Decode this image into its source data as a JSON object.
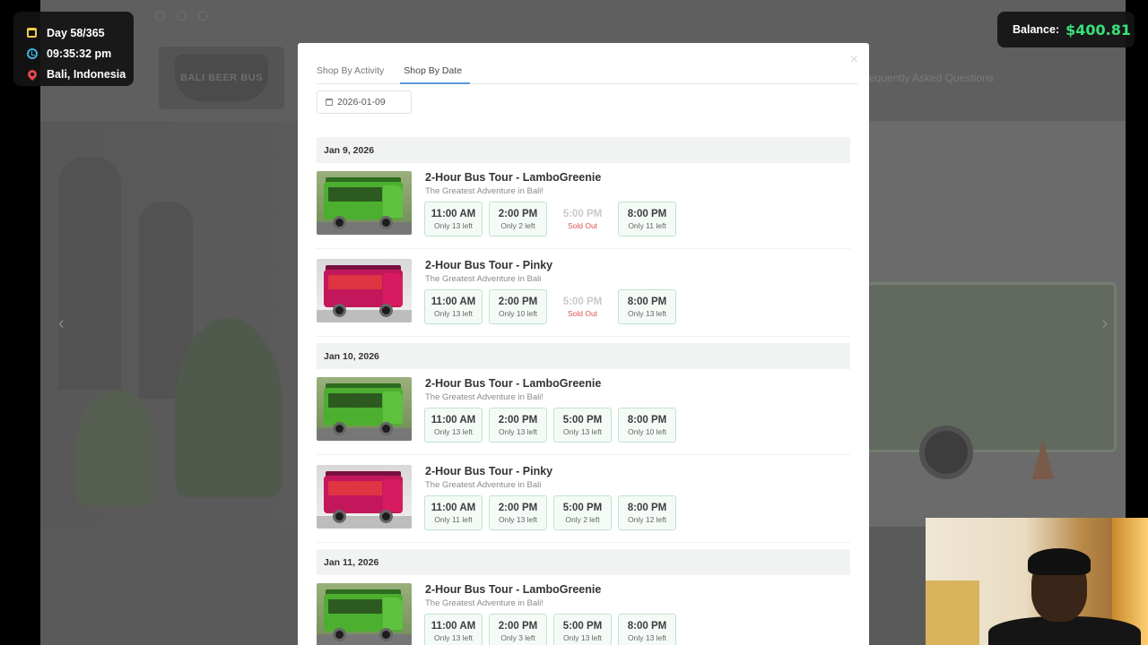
{
  "hud": {
    "day": "Day 58/365",
    "time": "09:35:32 pm",
    "location": "Bali, Indonesia"
  },
  "balance": {
    "label": "Balance:",
    "value": "$400.81",
    "value_color": "#39e07a"
  },
  "background_site": {
    "logo_text": "BALI BEER BUS",
    "nav_faq": "requently Asked Questions"
  },
  "modal": {
    "tabs": [
      {
        "label": "Shop By Activity",
        "active": false
      },
      {
        "label": "Shop By Date",
        "active": true
      }
    ],
    "date_value": "2026-01-09",
    "days": [
      {
        "date": "Jan 9, 2026",
        "tours": [
          {
            "name": "2-Hour Bus Tour - LamboGreenie",
            "tagline": "The Greatest Adventure in Bali!",
            "image": "green-bus",
            "slots": [
              {
                "time": "11:00 AM",
                "status": "Only 13 left",
                "sold_out": false
              },
              {
                "time": "2:00 PM",
                "status": "Only 2 left",
                "sold_out": false
              },
              {
                "time": "5:00 PM",
                "status": "Sold Out",
                "sold_out": true
              },
              {
                "time": "8:00 PM",
                "status": "Only 11 left",
                "sold_out": false
              }
            ]
          },
          {
            "name": "2-Hour Bus Tour - Pinky",
            "tagline": "The Greatest Adventure in Bali",
            "image": "pink-bus",
            "slots": [
              {
                "time": "11:00 AM",
                "status": "Only 13 left",
                "sold_out": false
              },
              {
                "time": "2:00 PM",
                "status": "Only 10 left",
                "sold_out": false
              },
              {
                "time": "5:00 PM",
                "status": "Sold Out",
                "sold_out": true
              },
              {
                "time": "8:00 PM",
                "status": "Only 13 left",
                "sold_out": false
              }
            ]
          }
        ]
      },
      {
        "date": "Jan 10, 2026",
        "tours": [
          {
            "name": "2-Hour Bus Tour - LamboGreenie",
            "tagline": "The Greatest Adventure in Bali!",
            "image": "green-bus",
            "slots": [
              {
                "time": "11:00 AM",
                "status": "Only 13 left",
                "sold_out": false
              },
              {
                "time": "2:00 PM",
                "status": "Only 13 left",
                "sold_out": false
              },
              {
                "time": "5:00 PM",
                "status": "Only 13 left",
                "sold_out": false
              },
              {
                "time": "8:00 PM",
                "status": "Only 10 left",
                "sold_out": false
              }
            ]
          },
          {
            "name": "2-Hour Bus Tour - Pinky",
            "tagline": "The Greatest Adventure in Bali",
            "image": "pink-bus",
            "slots": [
              {
                "time": "11:00 AM",
                "status": "Only 11 left",
                "sold_out": false
              },
              {
                "time": "2:00 PM",
                "status": "Only 13 left",
                "sold_out": false
              },
              {
                "time": "5:00 PM",
                "status": "Only 2 left",
                "sold_out": false
              },
              {
                "time": "8:00 PM",
                "status": "Only 12 left",
                "sold_out": false
              }
            ]
          }
        ]
      },
      {
        "date": "Jan 11, 2026",
        "tours": [
          {
            "name": "2-Hour Bus Tour - LamboGreenie",
            "tagline": "The Greatest Adventure in Bali!",
            "image": "green-bus",
            "slots": [
              {
                "time": "11:00 AM",
                "status": "Only 13 left",
                "sold_out": false
              },
              {
                "time": "2:00 PM",
                "status": "Only 3 left",
                "sold_out": false
              },
              {
                "time": "5:00 PM",
                "status": "Only 13 left",
                "sold_out": false
              },
              {
                "time": "8:00 PM",
                "status": "Only 13 left",
                "sold_out": false
              }
            ]
          }
        ]
      }
    ]
  },
  "colors": {
    "slot_border": "#bfe4cf",
    "slot_bg": "#f4fbf6",
    "sold_out_text": "#d9534f",
    "tab_active_underline": "#5b9bd5",
    "green_bus": "#4caf2f",
    "pink_bus": "#c2185b"
  }
}
